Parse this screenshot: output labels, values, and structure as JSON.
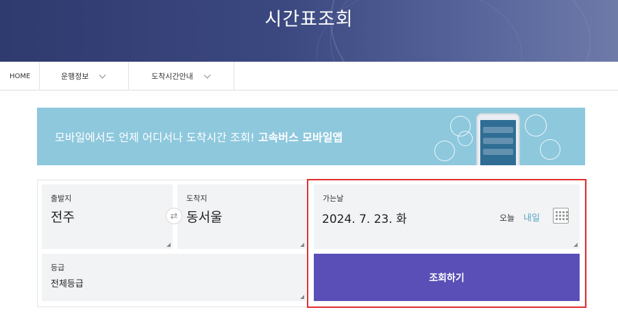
{
  "header": {
    "title": "시간표조회"
  },
  "nav": {
    "home": "HOME",
    "route_info": "운행정보",
    "arrival_info": "도착시간안내"
  },
  "promo": {
    "text": "모바일에서도 언제 어디서나 도착시간 조회! ",
    "bold": "고속버스 모바일앱"
  },
  "form": {
    "departure": {
      "label": "출발지",
      "value": "전주"
    },
    "arrival": {
      "label": "도착지",
      "value": "동서울"
    },
    "swap_icon": "⇄",
    "grade": {
      "label": "등급",
      "value": "전체등급"
    },
    "date": {
      "label": "가는날",
      "value": "2024. 7. 23. 화",
      "today": "오늘",
      "tomorrow": "내일"
    },
    "search_button": "조회하기"
  },
  "colors": {
    "header_bg": "#3b4880",
    "promo_bg": "#8ec8dd",
    "button_bg": "#5a4fb7",
    "highlight": "#e02b2b",
    "tomorrow_link": "#5aa5c4"
  }
}
